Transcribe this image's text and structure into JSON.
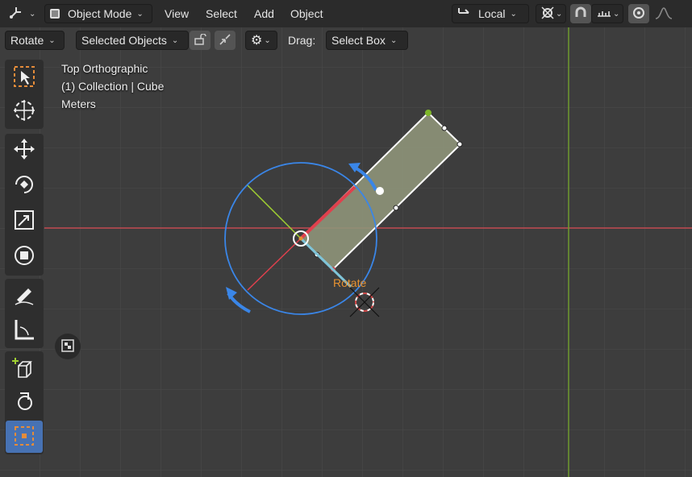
{
  "header": {
    "editor_type_icon": "axes-icon",
    "mode": "Object Mode",
    "menus": [
      "View",
      "Select",
      "Add",
      "Object"
    ],
    "orientation_icon": "orientation-icon",
    "orientation": "Local"
  },
  "tool_settings": {
    "rotation": "Rotate",
    "affect": "Selected Objects",
    "drag_label": "Drag:",
    "drag_value": "Select Box"
  },
  "overlay": {
    "view_name": "Top Orthographic",
    "collection_line": "(1) Collection | Cube",
    "units": "Meters",
    "gizmo_label": "Rotate"
  },
  "toolbar": {
    "tools": [
      "select-box",
      "cursor",
      "move",
      "rotate",
      "scale",
      "transform",
      "annotate",
      "measure",
      "add-cube",
      "spin",
      "active-object"
    ],
    "active_tool": "active-object"
  },
  "colors": {
    "x_axis": "#c24b52",
    "y_axis": "#6f9a2e",
    "gizmo": "#3a86e8",
    "selected": "#e79231",
    "active_tool": "#4772b3"
  }
}
